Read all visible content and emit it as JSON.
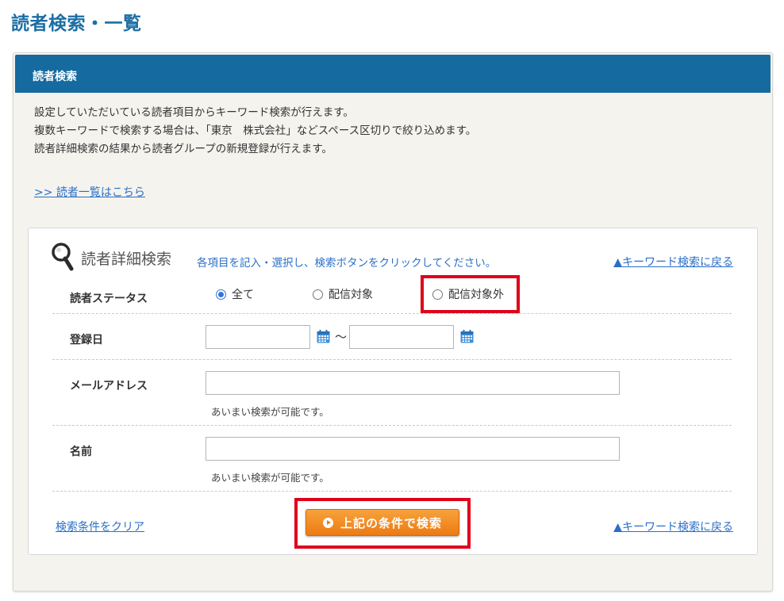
{
  "page_title": "読者検索・一覧",
  "panel": {
    "header": "読者検索",
    "description": [
      "設定していただいている読者項目からキーワード検索が行えます。",
      "複数キーワードで検索する場合は、「東京　株式会社」などスペース区切りで絞り込めます。",
      "読者詳細検索の結果から読者グループの新規登録が行えます。"
    ],
    "list_link": ">> 読者一覧はこちら"
  },
  "detail_search": {
    "title": "読者詳細検索",
    "hint": "各項目を記入・選択し、検索ボタンをクリックしてください。",
    "back_link": "▲キーワード検索に戻る",
    "status": {
      "label": "読者ステータス",
      "options": [
        "全て",
        "配信対象",
        "配信対象外"
      ],
      "selected": "全て"
    },
    "registration_date": {
      "label": "登録日",
      "separator": "〜",
      "from_value": "",
      "to_value": ""
    },
    "email": {
      "label": "メールアドレス",
      "value": "",
      "note": "あいまい検索が可能です。"
    },
    "name": {
      "label": "名前",
      "value": "",
      "note": "あいまい検索が可能です。"
    },
    "clear_link": "検索条件をクリア",
    "search_button": "上記の条件で検索"
  },
  "colors": {
    "title": "#1c6ea4",
    "header_bg": "#156aa0",
    "link": "#2a6fc9",
    "button": "#ed7a12",
    "highlight": "#e0001b",
    "radio_selected": "#2f78d4"
  }
}
